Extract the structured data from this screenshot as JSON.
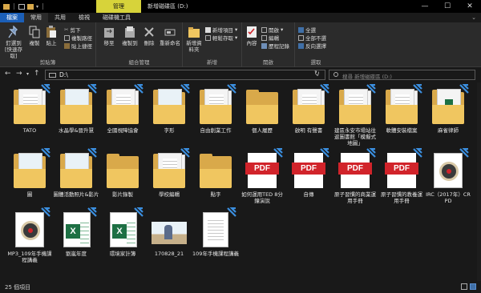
{
  "window": {
    "context_tab": "管理",
    "title": "新增磁碟區 (D:)",
    "minimize": "—",
    "maximize": "☐",
    "close": "✕"
  },
  "tabs": [
    {
      "label": "檔案"
    },
    {
      "label": "常用"
    },
    {
      "label": "共用"
    },
    {
      "label": "檢視"
    },
    {
      "label": "磁碟機工具"
    }
  ],
  "ribbon": {
    "clipboard": {
      "label": "剪貼簿",
      "pin_quick": "釘選到 [快速存取]",
      "copy": "複製",
      "paste": "貼上",
      "cut": "剪下",
      "copy_path": "複製路徑",
      "paste_shortcut": "貼上捷徑"
    },
    "organize": {
      "label": "組合管理",
      "move_to": "移至",
      "copy_to": "複製到",
      "delete": "刪除",
      "rename": "重新命名"
    },
    "new": {
      "label": "新增",
      "new_folder": "新增資料夾",
      "new_item": "新增項目",
      "easy_access": "輕鬆存取"
    },
    "open": {
      "label": "開啟",
      "properties": "內容",
      "open": "開啟",
      "edit": "編輯",
      "history": "歷程記錄"
    },
    "select": {
      "label": "選取",
      "select_all": "全選",
      "select_none": "全部不選",
      "invert": "反向選擇"
    }
  },
  "address": {
    "path": "D:\\",
    "search_placeholder": "搜尋 新增磁碟區 (D:)"
  },
  "items": [
    {
      "name": "TATO",
      "kind": "folder-doc"
    },
    {
      "name": "水晶學&晉升慧",
      "kind": "folder-img"
    },
    {
      "name": "全國視障協會",
      "kind": "folder-doc"
    },
    {
      "name": "字形",
      "kind": "folder-img"
    },
    {
      "name": "自由創業工作",
      "kind": "folder-doc"
    },
    {
      "name": "個人履歷",
      "kind": "folder"
    },
    {
      "name": "啟明 有聲書",
      "kind": "folder-doc"
    },
    {
      "name": "建區永安市場站往返圖書館「模擬式地圖」",
      "kind": "folder-doc"
    },
    {
      "name": "軟體安裝檔案",
      "kind": "folder-doc"
    },
    {
      "name": "麻雀律師",
      "kind": "folder-xls"
    },
    {
      "name": "圖",
      "kind": "folder-img"
    },
    {
      "name": "圖體活動照片&影片",
      "kind": "folder-img"
    },
    {
      "name": "影片錄製",
      "kind": "folder"
    },
    {
      "name": "學校編輯",
      "kind": "folder-doc"
    },
    {
      "name": "點字",
      "kind": "folder"
    },
    {
      "name": "如何運用TED 8分鐘演說",
      "kind": "pdf"
    },
    {
      "name": "自傳",
      "kind": "pdf"
    },
    {
      "name": "原子習慣的商業運用手冊",
      "kind": "pdf"
    },
    {
      "name": "原子習慣的教養運用手冊",
      "kind": "pdf"
    },
    {
      "name": "IRC（2017年）CRPD",
      "kind": "mp3"
    },
    {
      "name": "MP3_109年手機課程講義",
      "kind": "mp3"
    },
    {
      "name": "劉嵐年度",
      "kind": "xls"
    },
    {
      "name": "環境家計簿",
      "kind": "xls"
    },
    {
      "name": "170828_21",
      "kind": "image"
    },
    {
      "name": "109年手機課程講義",
      "kind": "doc"
    }
  ],
  "status": {
    "count": "25 個項目"
  },
  "colors": {
    "file_tab": "#1b5fb8",
    "context_tab": "#d7d33a",
    "folder": "#f0c660",
    "pdf_red": "#d1232a",
    "excel_green": "#1d7044"
  }
}
